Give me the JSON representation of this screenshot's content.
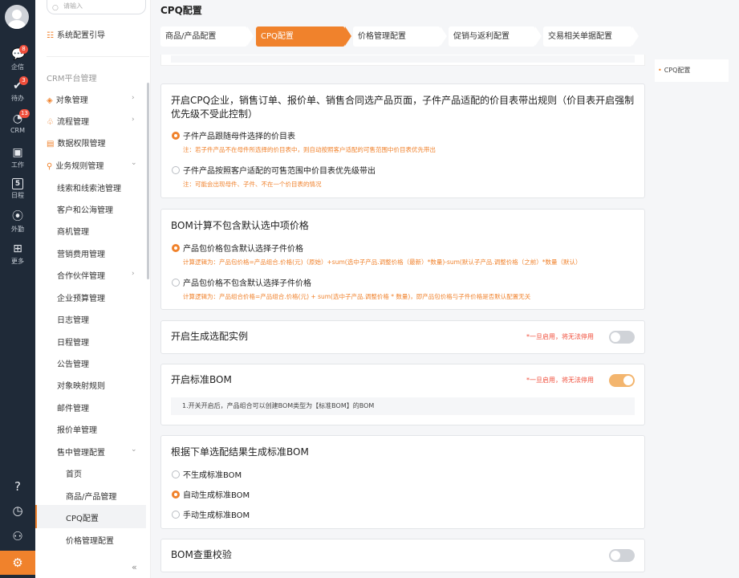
{
  "rail": {
    "items": [
      {
        "label": "企信",
        "icon": "chat-icon",
        "badge": "8"
      },
      {
        "label": "待办",
        "icon": "todo-icon",
        "badge": "3"
      },
      {
        "label": "CRM",
        "icon": "crm-icon",
        "badge": "13"
      },
      {
        "label": "工作",
        "icon": "work-icon",
        "badge": ""
      },
      {
        "label": "日程",
        "icon": "calendar-icon",
        "badge": "",
        "day": "5"
      },
      {
        "label": "外勤",
        "icon": "location-icon",
        "badge": ""
      },
      {
        "label": "更多",
        "icon": "grid-icon",
        "badge": ""
      }
    ],
    "bottom_icons": [
      "help-icon",
      "history-icon",
      "user-settings-icon",
      "admin-gear-icon"
    ]
  },
  "sidebar": {
    "search_placeholder": "请输入",
    "guide": "系统配置引导",
    "group": "CRM平台管理",
    "items": [
      {
        "label": "对象管理",
        "chevron": "right"
      },
      {
        "label": "流程管理",
        "chevron": "right"
      },
      {
        "label": "数据权限管理",
        "chevron": ""
      },
      {
        "label": "业务规则管理",
        "chevron": "down"
      }
    ],
    "sub_items": [
      "线索和线索池管理",
      "客户和公海管理",
      "商机管理",
      "营销费用管理",
      "合作伙伴管理",
      "企业预算管理",
      "日志管理",
      "日程管理",
      "公告管理",
      "对象映射规则",
      "邮件管理",
      "报价单管理",
      "售中管理配置"
    ],
    "sub_sub_items": [
      "首页",
      "商品/产品管理",
      "CPQ配置",
      "价格管理配置"
    ],
    "active_item": "CPQ配置",
    "collapse_label": "«"
  },
  "page": {
    "title": "CPQ配置",
    "tabs": [
      "商品/产品配置",
      "CPQ配置",
      "价格管理配置",
      "促销与返利配置",
      "交易相关单据配置"
    ],
    "active_tab": "CPQ配置"
  },
  "sections": {
    "price_rule": {
      "title": "开启CPQ企业，销售订单、报价单、销售合同选产品页面，子件产品适配的价目表带出规则（价目表开启强制优先级不受此控制）",
      "options": [
        {
          "label": "子件产品跟随母件选择的价目表",
          "selected": true,
          "note": "注：若子件产品不在母件所选择的价目表中，则自动按照客户适配的可售范围中价目表优先带出"
        },
        {
          "label": "子件产品按照客户适配的可售范围中价目表优先级带出",
          "selected": false,
          "note": "注：可能会出现母件、子件、不在一个价目表的情况"
        }
      ]
    },
    "bom_calc": {
      "title": "BOM计算不包含默认选中项价格",
      "options": [
        {
          "label": "产品包价格包含默认选择子件价格",
          "selected": true,
          "note": "计算逻辑为：产品包价格=产品组合.价格(元)（原始）+sum(选中子产品.调整价格（最新）*数量)-sum(默认子产品.调整价格（之前）*数量（默认）"
        },
        {
          "label": "产品包价格不包含默认选择子件价格",
          "selected": false,
          "note": "计算逻辑为：产品组合价格=产品组合.价格(元) + sum(选中子产品.调整价格 * 数量)，即产品包价格与子件价格是否默认配置无关"
        }
      ]
    },
    "gen_instance": {
      "title": "开启生成选配实例",
      "warning": "*一旦启用，将无法停用",
      "enabled": false
    },
    "standard_bom": {
      "title": "开启标准BOM",
      "warning": "*一旦启用，将无法停用",
      "enabled": true,
      "info": "1.开关开启后，产品组合可以创建BOM类型为【标准BOM】的BOM"
    },
    "gen_standard": {
      "title": "根据下单选配结果生成标准BOM",
      "options": [
        {
          "label": "不生成标准BOM",
          "selected": false
        },
        {
          "label": "自动生成标准BOM",
          "selected": true
        },
        {
          "label": "手动生成标准BOM",
          "selected": false
        }
      ]
    },
    "bom_check": {
      "title": "BOM查重校验",
      "enabled": false
    }
  },
  "right_nav": {
    "label": "CPQ配置"
  },
  "colors": {
    "accent": "#f0822c",
    "rail_bg": "#1f2a38",
    "warning": "#f04f3c"
  }
}
